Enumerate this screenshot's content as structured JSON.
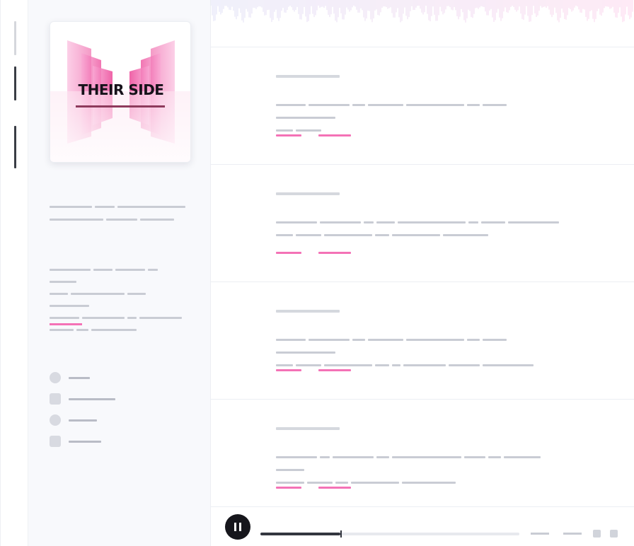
{
  "rail": {
    "items": [
      "",
      "",
      ""
    ]
  },
  "podcast": {
    "cover_title": "THEIR SIDE",
    "about_heading": "",
    "about_text": "",
    "hosts_heading": "",
    "hosts_text": "",
    "show_more": "",
    "links_heading": ""
  },
  "filters": [
    {
      "shape": "round",
      "label": ""
    },
    {
      "shape": "square",
      "label": ""
    },
    {
      "shape": "round",
      "label": ""
    },
    {
      "shape": "square",
      "label": ""
    }
  ],
  "main": {
    "page_title": ""
  },
  "episodes": [
    {
      "date": "",
      "title": "",
      "description": "",
      "action_1": "",
      "action_2": ""
    },
    {
      "date": "",
      "title": "",
      "description": "",
      "action_1": "",
      "action_2": ""
    },
    {
      "date": "",
      "title": "",
      "description": "",
      "action_1": "",
      "action_2": ""
    },
    {
      "date": "",
      "title": "",
      "description": "",
      "action_1": "",
      "action_2": ""
    }
  ],
  "player": {
    "now_playing": "",
    "progress": 0.31,
    "elapsed": "",
    "remaining": "",
    "state": "playing"
  },
  "colors": {
    "accent": "#f472b6",
    "cover_pink": "#f9a8d4",
    "text_dark": "#2f3340",
    "text_placeholder": "#c6c9d2",
    "sidebar_bg": "#f8f9fc",
    "play_button": "#16161c"
  },
  "icons": {
    "play_pause": "pause-icon",
    "player_control_1": "rewind-icon",
    "player_control_2": "forward-icon"
  }
}
